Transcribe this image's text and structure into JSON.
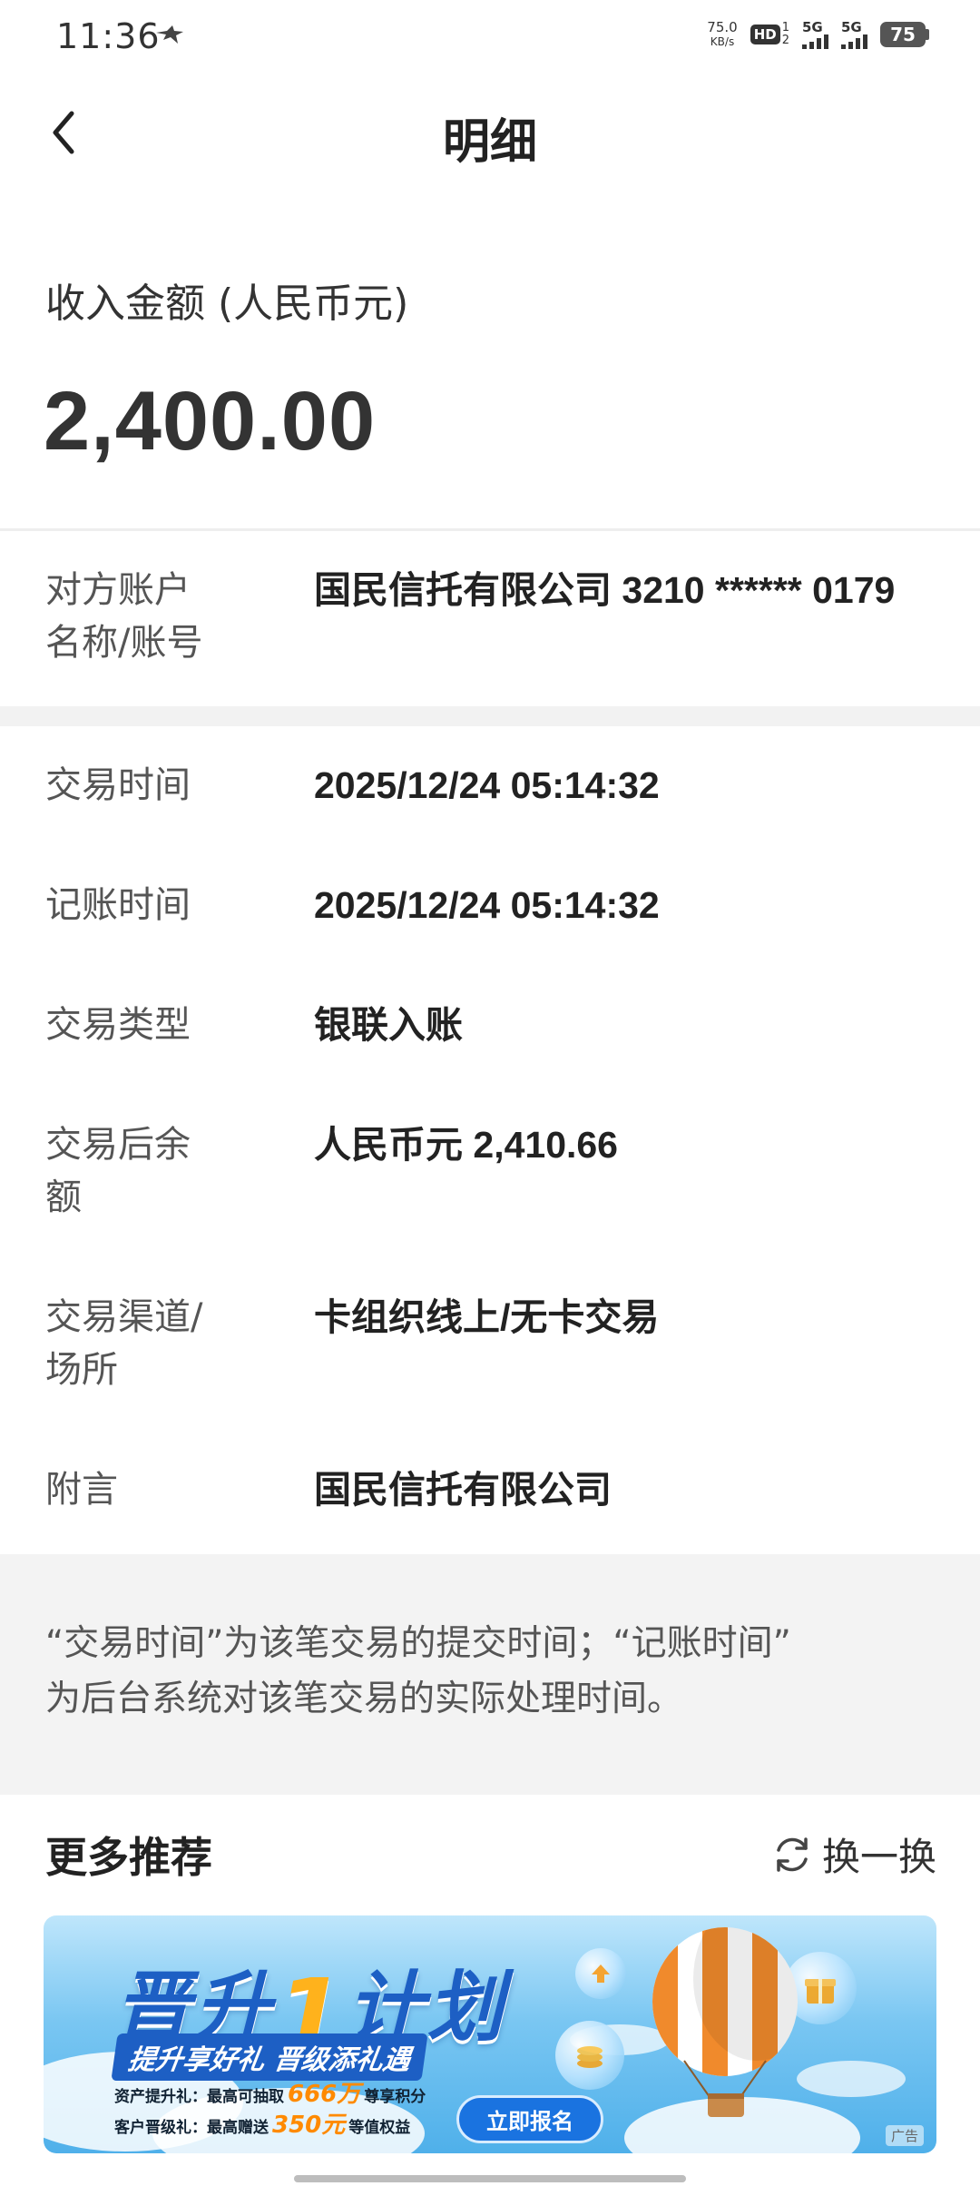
{
  "status_bar": {
    "time": "11:36",
    "net_speed_value": "75.0",
    "net_speed_unit": "KB/s",
    "hd_label": "HD",
    "hd_sub_top": "1",
    "hd_sub_bottom": "2",
    "sim1_label": "5G",
    "sim2_label": "5G",
    "battery": "75",
    "icons": [
      "bird-icon",
      "hd-icon",
      "signal-icon",
      "battery-icon"
    ]
  },
  "nav": {
    "back_icon": "chevron-left-icon",
    "title": "明细"
  },
  "amount": {
    "label": "收入金额 (人民币元)",
    "value": "2,400.00"
  },
  "counterparty": {
    "label_line1": "对方账户",
    "label_line2": "名称/账号",
    "value": "国民信托有限公司 3210 ****** 0179"
  },
  "details": [
    {
      "label": [
        "交易时间"
      ],
      "value": "2025/12/24 05:14:32"
    },
    {
      "label": [
        "记账时间"
      ],
      "value": "2025/12/24 05:14:32"
    },
    {
      "label": [
        "交易类型"
      ],
      "value": "银联入账"
    },
    {
      "label": [
        "交易后余",
        "额"
      ],
      "value": "人民币元 2,410.66"
    },
    {
      "label": [
        "交易渠道/",
        "场所"
      ],
      "value": "卡组织线上/无卡交易"
    },
    {
      "label": [
        "附言"
      ],
      "value": "国民信托有限公司"
    }
  ],
  "note": {
    "line1": "“交易时间”为该笔交易的提交时间；“记账时间”",
    "line2": "为后台系统对该笔交易的实际处理时间。"
  },
  "more": {
    "title": "更多推荐",
    "refresh_label": "换一换",
    "refresh_icon": "refresh-icon"
  },
  "banner": {
    "title_left": "晋升",
    "title_number": "1",
    "title_right": "计划",
    "subtitle": "提升享好礼 晋级添礼遇",
    "line1_prefix": "资产提升礼：最高可抽取",
    "line1_highlight": "666万",
    "line1_suffix": "尊享积分",
    "line2_prefix": "客户晋级礼：最高赠送",
    "line2_highlight": "350元",
    "line2_suffix": "等值权益",
    "cta": "立即报名",
    "ad_tag": "广告",
    "colors": {
      "title": "#1d5fc4",
      "highlight": "#ff8a00",
      "cta": "#1a73e0"
    }
  }
}
